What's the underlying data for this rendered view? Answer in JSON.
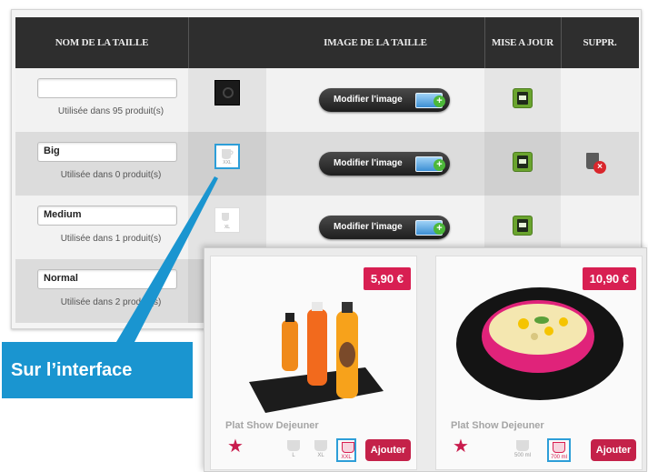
{
  "table": {
    "headers": {
      "size_name": "NOM DE LA TAILLE",
      "size_image": "IMAGE DE LA TAILLE",
      "update": "MISE A JOUR",
      "delete": "SUPPR."
    },
    "rows": [
      {
        "name": "",
        "usage": "Utilisée dans 95 produit(s)",
        "thumb": "black-cup-icon",
        "thumb_label": "",
        "modify_label": "Modifier l'image",
        "deletable": false
      },
      {
        "name": "Big",
        "usage": "Utilisée dans 0 produit(s)",
        "thumb": "xxl-cup-icon",
        "thumb_label": "XXL",
        "modify_label": "Modifier l'image",
        "deletable": true
      },
      {
        "name": "Medium",
        "usage": "Utilisée dans 1 produit(s)",
        "thumb": "xl-cup-icon",
        "thumb_label": "XL",
        "modify_label": "Modifier l'image",
        "deletable": false
      },
      {
        "name": "Normal",
        "usage": "Utilisée dans 2 produit(s)",
        "thumb": "",
        "thumb_label": "",
        "modify_label": "",
        "deletable": false
      }
    ]
  },
  "callout": {
    "text": "Sur l’interface",
    "color": "#1a95d0"
  },
  "shop": {
    "cards": [
      {
        "price": "5,90 €",
        "name": "Plat Show Dejeuner",
        "image": "juice-bottles-photo",
        "options": [
          {
            "label": "L",
            "selected": false
          },
          {
            "label": "XL",
            "selected": false
          },
          {
            "label": "XXL",
            "selected": true
          }
        ],
        "add_label": "Ajouter"
      },
      {
        "price": "10,90 €",
        "name": "Plat Show Dejeuner",
        "image": "salad-bowl-photo",
        "options": [
          {
            "label": "500 ml",
            "selected": false
          },
          {
            "label": "700 ml",
            "selected": true
          }
        ],
        "add_label": "Ajouter"
      }
    ]
  },
  "colors": {
    "price_tag": "#d81f52",
    "add_button": "#c42149",
    "save_button": "#6aa42e",
    "highlight": "#2d9ed8"
  }
}
